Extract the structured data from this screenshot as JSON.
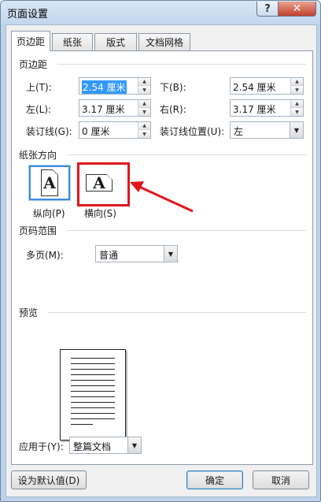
{
  "window": {
    "title": "页面设置",
    "help_glyph": "?",
    "close_glyph": "✕"
  },
  "tabs": [
    {
      "label": "页边距",
      "active": true
    },
    {
      "label": "纸张",
      "active": false
    },
    {
      "label": "版式",
      "active": false
    },
    {
      "label": "文档网格",
      "active": false
    }
  ],
  "margins": {
    "group_title": "页边距",
    "top": {
      "label": "上(T):",
      "value": "2.54 厘米"
    },
    "bottom": {
      "label": "下(B):",
      "value": "2.54 厘米"
    },
    "left": {
      "label": "左(L):",
      "value": "3.17 厘米"
    },
    "right": {
      "label": "右(R):",
      "value": "3.17 厘米"
    },
    "gutter": {
      "label": "装订线(G):",
      "value": "0 厘米"
    },
    "gutter_position": {
      "label": "装订线位置(U):",
      "value": "左"
    }
  },
  "orientation": {
    "group_title": "纸张方向",
    "portrait": {
      "label": "纵向(P)",
      "glyph": "A",
      "selected": true
    },
    "landscape": {
      "label": "横向(S)",
      "glyph": "A",
      "selected": false
    }
  },
  "pages": {
    "group_title": "页码范围",
    "multiple_label": "多页(M):",
    "multiple_value": "普通"
  },
  "preview": {
    "group_title": "预览",
    "apply_label": "应用于(Y):",
    "apply_value": "整篇文档"
  },
  "buttons": {
    "set_default": "设为默认值(D)",
    "ok": "确定",
    "cancel": "取消"
  },
  "colors": {
    "annotation_red": "#e0151b",
    "selection_blue": "#3399ff"
  }
}
